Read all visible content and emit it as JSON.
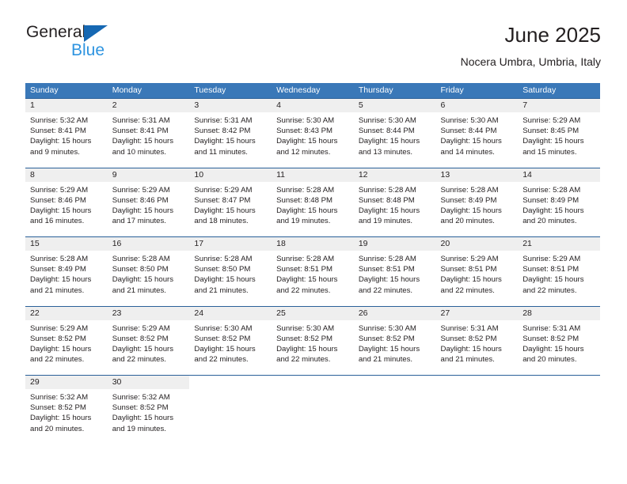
{
  "brand": {
    "word_general": "General",
    "word_blue": "Blue",
    "triangle_color": "#1668b3",
    "blue_color": "#2e94e0"
  },
  "header": {
    "month_title": "June 2025",
    "location": "Nocera Umbra, Umbria, Italy"
  },
  "calendar": {
    "header_bg": "#3a78b8",
    "row_border": "#2a6099",
    "daynum_bg": "#efefef",
    "weekdays": [
      "Sunday",
      "Monday",
      "Tuesday",
      "Wednesday",
      "Thursday",
      "Friday",
      "Saturday"
    ],
    "weeks": [
      [
        {
          "day": "1",
          "sunrise": "Sunrise: 5:32 AM",
          "sunset": "Sunset: 8:41 PM",
          "daylight1": "Daylight: 15 hours",
          "daylight2": "and 9 minutes."
        },
        {
          "day": "2",
          "sunrise": "Sunrise: 5:31 AM",
          "sunset": "Sunset: 8:41 PM",
          "daylight1": "Daylight: 15 hours",
          "daylight2": "and 10 minutes."
        },
        {
          "day": "3",
          "sunrise": "Sunrise: 5:31 AM",
          "sunset": "Sunset: 8:42 PM",
          "daylight1": "Daylight: 15 hours",
          "daylight2": "and 11 minutes."
        },
        {
          "day": "4",
          "sunrise": "Sunrise: 5:30 AM",
          "sunset": "Sunset: 8:43 PM",
          "daylight1": "Daylight: 15 hours",
          "daylight2": "and 12 minutes."
        },
        {
          "day": "5",
          "sunrise": "Sunrise: 5:30 AM",
          "sunset": "Sunset: 8:44 PM",
          "daylight1": "Daylight: 15 hours",
          "daylight2": "and 13 minutes."
        },
        {
          "day": "6",
          "sunrise": "Sunrise: 5:30 AM",
          "sunset": "Sunset: 8:44 PM",
          "daylight1": "Daylight: 15 hours",
          "daylight2": "and 14 minutes."
        },
        {
          "day": "7",
          "sunrise": "Sunrise: 5:29 AM",
          "sunset": "Sunset: 8:45 PM",
          "daylight1": "Daylight: 15 hours",
          "daylight2": "and 15 minutes."
        }
      ],
      [
        {
          "day": "8",
          "sunrise": "Sunrise: 5:29 AM",
          "sunset": "Sunset: 8:46 PM",
          "daylight1": "Daylight: 15 hours",
          "daylight2": "and 16 minutes."
        },
        {
          "day": "9",
          "sunrise": "Sunrise: 5:29 AM",
          "sunset": "Sunset: 8:46 PM",
          "daylight1": "Daylight: 15 hours",
          "daylight2": "and 17 minutes."
        },
        {
          "day": "10",
          "sunrise": "Sunrise: 5:29 AM",
          "sunset": "Sunset: 8:47 PM",
          "daylight1": "Daylight: 15 hours",
          "daylight2": "and 18 minutes."
        },
        {
          "day": "11",
          "sunrise": "Sunrise: 5:28 AM",
          "sunset": "Sunset: 8:48 PM",
          "daylight1": "Daylight: 15 hours",
          "daylight2": "and 19 minutes."
        },
        {
          "day": "12",
          "sunrise": "Sunrise: 5:28 AM",
          "sunset": "Sunset: 8:48 PM",
          "daylight1": "Daylight: 15 hours",
          "daylight2": "and 19 minutes."
        },
        {
          "day": "13",
          "sunrise": "Sunrise: 5:28 AM",
          "sunset": "Sunset: 8:49 PM",
          "daylight1": "Daylight: 15 hours",
          "daylight2": "and 20 minutes."
        },
        {
          "day": "14",
          "sunrise": "Sunrise: 5:28 AM",
          "sunset": "Sunset: 8:49 PM",
          "daylight1": "Daylight: 15 hours",
          "daylight2": "and 20 minutes."
        }
      ],
      [
        {
          "day": "15",
          "sunrise": "Sunrise: 5:28 AM",
          "sunset": "Sunset: 8:49 PM",
          "daylight1": "Daylight: 15 hours",
          "daylight2": "and 21 minutes."
        },
        {
          "day": "16",
          "sunrise": "Sunrise: 5:28 AM",
          "sunset": "Sunset: 8:50 PM",
          "daylight1": "Daylight: 15 hours",
          "daylight2": "and 21 minutes."
        },
        {
          "day": "17",
          "sunrise": "Sunrise: 5:28 AM",
          "sunset": "Sunset: 8:50 PM",
          "daylight1": "Daylight: 15 hours",
          "daylight2": "and 21 minutes."
        },
        {
          "day": "18",
          "sunrise": "Sunrise: 5:28 AM",
          "sunset": "Sunset: 8:51 PM",
          "daylight1": "Daylight: 15 hours",
          "daylight2": "and 22 minutes."
        },
        {
          "day": "19",
          "sunrise": "Sunrise: 5:28 AM",
          "sunset": "Sunset: 8:51 PM",
          "daylight1": "Daylight: 15 hours",
          "daylight2": "and 22 minutes."
        },
        {
          "day": "20",
          "sunrise": "Sunrise: 5:29 AM",
          "sunset": "Sunset: 8:51 PM",
          "daylight1": "Daylight: 15 hours",
          "daylight2": "and 22 minutes."
        },
        {
          "day": "21",
          "sunrise": "Sunrise: 5:29 AM",
          "sunset": "Sunset: 8:51 PM",
          "daylight1": "Daylight: 15 hours",
          "daylight2": "and 22 minutes."
        }
      ],
      [
        {
          "day": "22",
          "sunrise": "Sunrise: 5:29 AM",
          "sunset": "Sunset: 8:52 PM",
          "daylight1": "Daylight: 15 hours",
          "daylight2": "and 22 minutes."
        },
        {
          "day": "23",
          "sunrise": "Sunrise: 5:29 AM",
          "sunset": "Sunset: 8:52 PM",
          "daylight1": "Daylight: 15 hours",
          "daylight2": "and 22 minutes."
        },
        {
          "day": "24",
          "sunrise": "Sunrise: 5:30 AM",
          "sunset": "Sunset: 8:52 PM",
          "daylight1": "Daylight: 15 hours",
          "daylight2": "and 22 minutes."
        },
        {
          "day": "25",
          "sunrise": "Sunrise: 5:30 AM",
          "sunset": "Sunset: 8:52 PM",
          "daylight1": "Daylight: 15 hours",
          "daylight2": "and 22 minutes."
        },
        {
          "day": "26",
          "sunrise": "Sunrise: 5:30 AM",
          "sunset": "Sunset: 8:52 PM",
          "daylight1": "Daylight: 15 hours",
          "daylight2": "and 21 minutes."
        },
        {
          "day": "27",
          "sunrise": "Sunrise: 5:31 AM",
          "sunset": "Sunset: 8:52 PM",
          "daylight1": "Daylight: 15 hours",
          "daylight2": "and 21 minutes."
        },
        {
          "day": "28",
          "sunrise": "Sunrise: 5:31 AM",
          "sunset": "Sunset: 8:52 PM",
          "daylight1": "Daylight: 15 hours",
          "daylight2": "and 20 minutes."
        }
      ],
      [
        {
          "day": "29",
          "sunrise": "Sunrise: 5:32 AM",
          "sunset": "Sunset: 8:52 PM",
          "daylight1": "Daylight: 15 hours",
          "daylight2": "and 20 minutes."
        },
        {
          "day": "30",
          "sunrise": "Sunrise: 5:32 AM",
          "sunset": "Sunset: 8:52 PM",
          "daylight1": "Daylight: 15 hours",
          "daylight2": "and 19 minutes."
        },
        {
          "day": "",
          "sunrise": "",
          "sunset": "",
          "daylight1": "",
          "daylight2": ""
        },
        {
          "day": "",
          "sunrise": "",
          "sunset": "",
          "daylight1": "",
          "daylight2": ""
        },
        {
          "day": "",
          "sunrise": "",
          "sunset": "",
          "daylight1": "",
          "daylight2": ""
        },
        {
          "day": "",
          "sunrise": "",
          "sunset": "",
          "daylight1": "",
          "daylight2": ""
        },
        {
          "day": "",
          "sunrise": "",
          "sunset": "",
          "daylight1": "",
          "daylight2": ""
        }
      ]
    ]
  }
}
